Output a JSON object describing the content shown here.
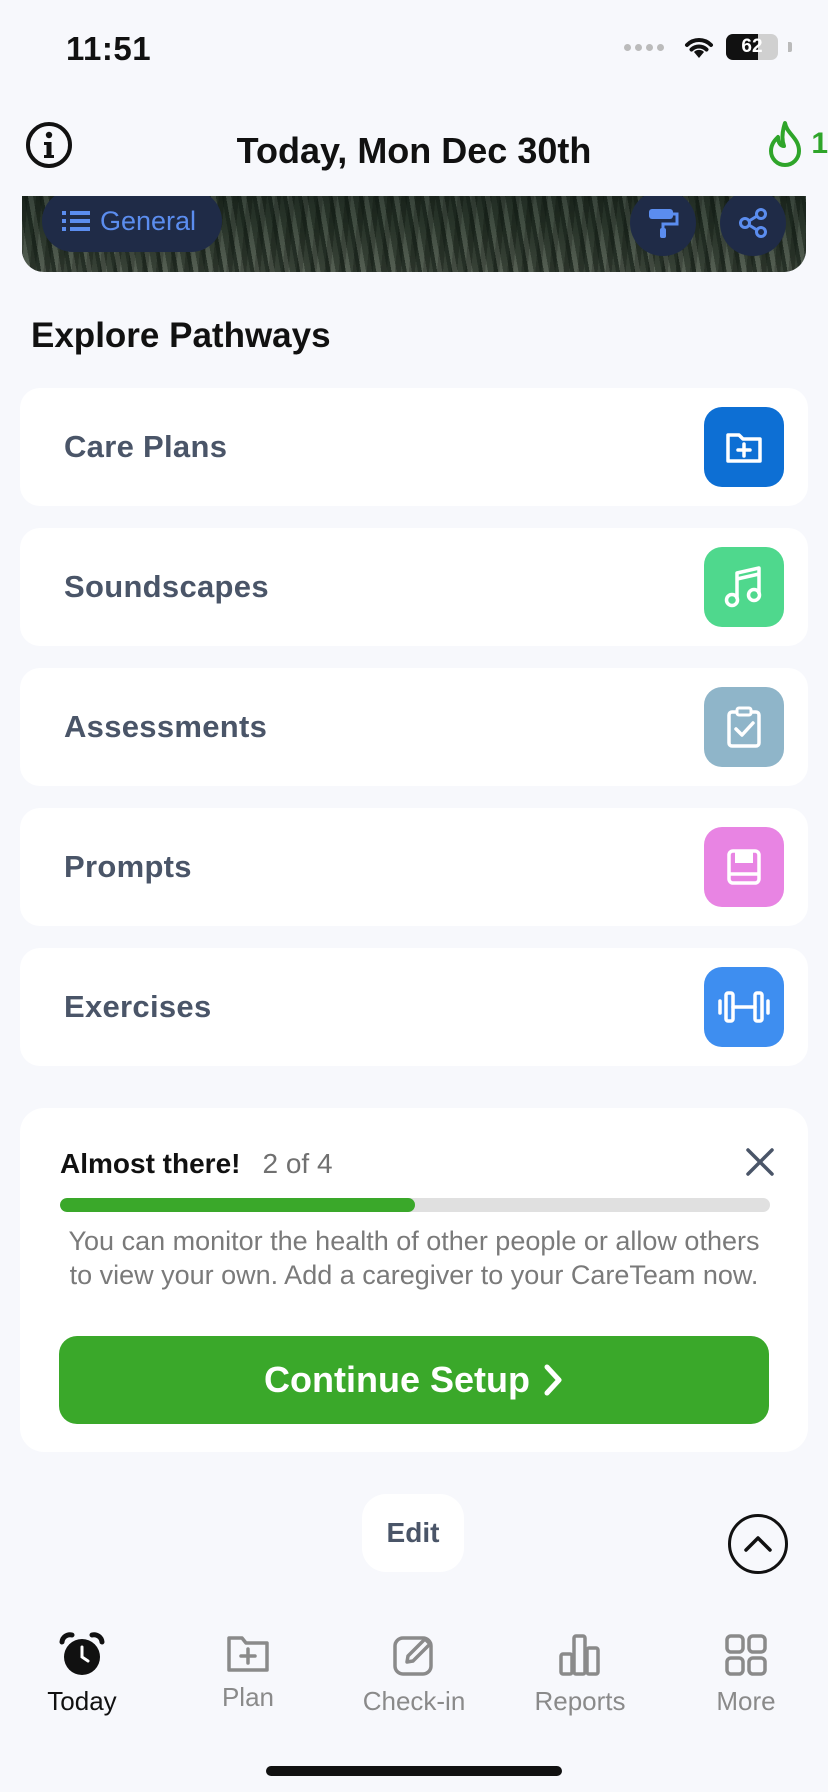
{
  "status_bar": {
    "time": "11:51",
    "battery": "62"
  },
  "header": {
    "title": "Today, Mon Dec 30th",
    "streak_count": "1"
  },
  "banner": {
    "chip_label": "General"
  },
  "explore": {
    "title": "Explore Pathways",
    "items": [
      {
        "label": "Care Plans",
        "icon": "folder-plus-icon",
        "color": "#0d6fd4"
      },
      {
        "label": "Soundscapes",
        "icon": "music-note-icon",
        "color": "#4fd88d"
      },
      {
        "label": "Assessments",
        "icon": "clipboard-check-icon",
        "color": "#8fb5c9"
      },
      {
        "label": "Prompts",
        "icon": "journal-icon",
        "color": "#e884e3"
      },
      {
        "label": "Exercises",
        "icon": "dumbbell-icon",
        "color": "#3e8ef0"
      }
    ]
  },
  "setup": {
    "title": "Almost there!",
    "count": "2 of 4",
    "progress": 0.5,
    "description": "You can monitor the health of other people or allow others to view your own. Add a caregiver to your CareTeam now.",
    "button_label": "Continue Setup"
  },
  "edit_label": "Edit",
  "tabs": [
    {
      "label": "Today",
      "icon": "alarm-clock-icon",
      "active": true
    },
    {
      "label": "Plan",
      "icon": "folder-plus-icon",
      "active": false
    },
    {
      "label": "Check-in",
      "icon": "edit-square-icon",
      "active": false
    },
    {
      "label": "Reports",
      "icon": "bar-chart-icon",
      "active": false
    },
    {
      "label": "More",
      "icon": "grid-icon",
      "active": false
    }
  ],
  "colors": {
    "accent_green": "#3aa82a",
    "chip_text": "#5b8def",
    "text_muted": "#4a5568"
  }
}
